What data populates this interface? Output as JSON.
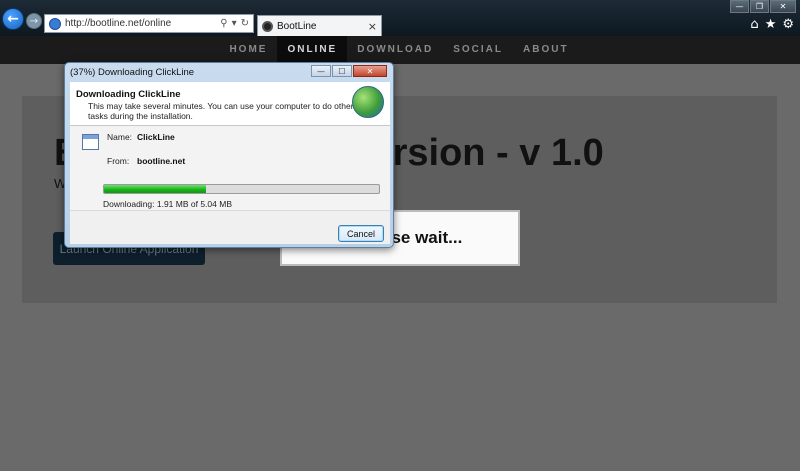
{
  "browser": {
    "url": "http://bootline.net/online",
    "tab_title": "BootLine",
    "tab_close": "×",
    "search_glyph": "⚲",
    "dropdown_glyph": "▾",
    "refresh_glyph": "↻",
    "window_buttons": {
      "minimize": "—",
      "maximize": "❐",
      "close": "✕"
    },
    "tool_icons": {
      "home": "⌂",
      "favorites": "★",
      "settings": "⚙"
    }
  },
  "site_nav": {
    "items": [
      {
        "label": "HOME"
      },
      {
        "label": "ONLINE",
        "active": true
      },
      {
        "label": "DOWNLOAD"
      },
      {
        "label": "SOCIAL"
      },
      {
        "label": "ABOUT"
      }
    ]
  },
  "page": {
    "heading_left": "B",
    "heading_right": "ersion - v 1.0",
    "subline": "W",
    "launch_button": "Launch Online Application",
    "wait_text": "ase wait..."
  },
  "dialog": {
    "title": "(37%) Downloading ClickLine",
    "heading": "Downloading ClickLine",
    "description": "This may take several minutes. You can use your computer to do other tasks during the installation.",
    "name_label": "Name:",
    "name_value": "ClickLine",
    "from_label": "From:",
    "from_value": "bootline.net",
    "progress_percent": 37,
    "progress_text": "Downloading: 1.91 MB of 5.04 MB",
    "cancel_label": "Cancel",
    "controls": {
      "minimize": "—",
      "maximize": "☐",
      "close": "✕"
    }
  },
  "colors": {
    "progress": "#18b018",
    "nav_background": "#1b1b1b",
    "back_button": "#1565c0"
  }
}
